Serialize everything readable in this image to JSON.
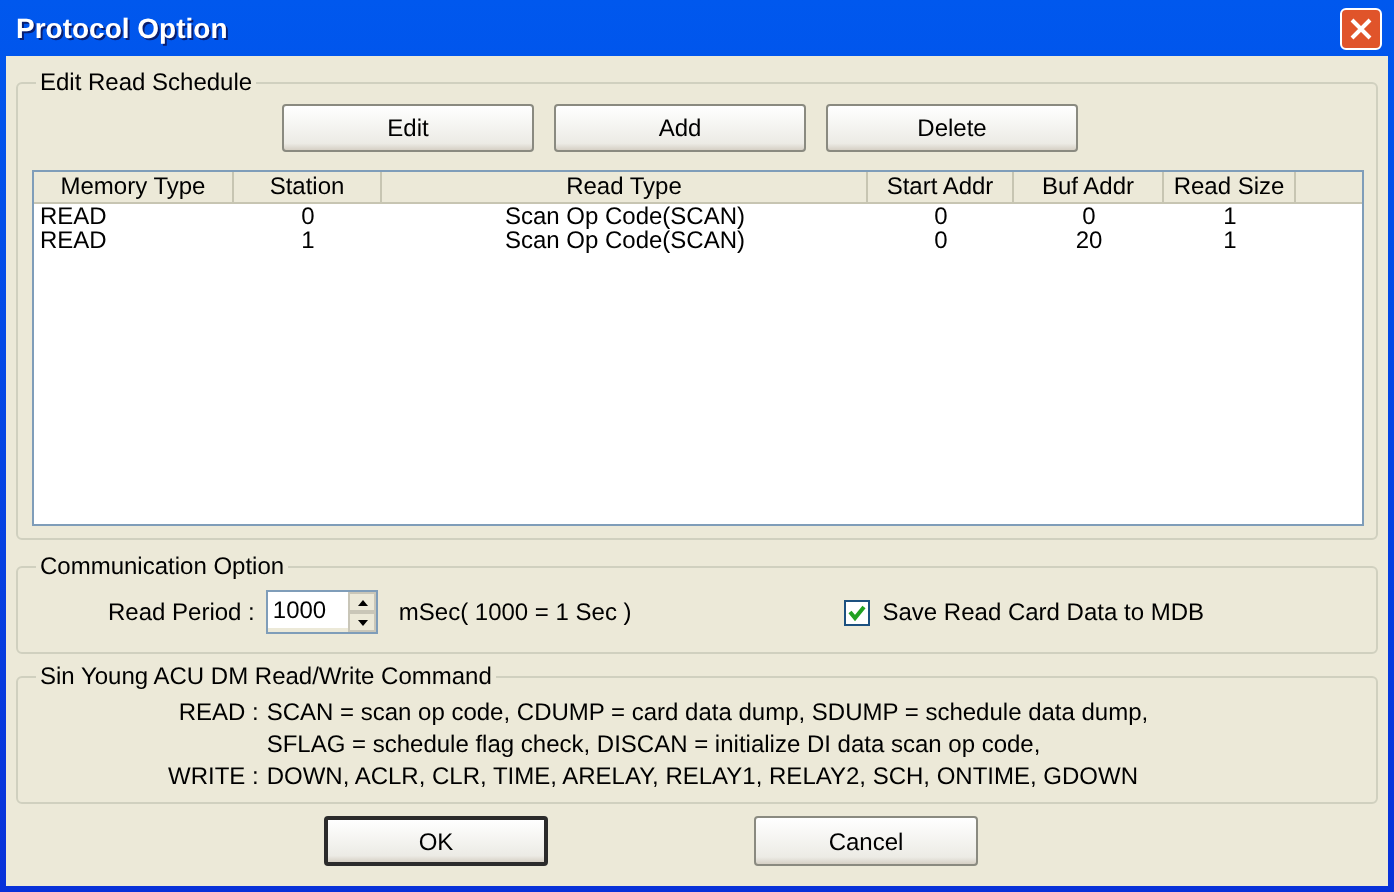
{
  "window": {
    "title": "Protocol Option"
  },
  "schedule": {
    "title": "Edit Read Schedule",
    "buttons": [
      "Edit",
      "Add",
      "Delete"
    ],
    "columns": [
      "Memory Type",
      "Station",
      "Read Type",
      "Start Addr",
      "Buf Addr",
      "Read Size"
    ],
    "rows": [
      {
        "cells": [
          "READ",
          "0",
          "Scan Op Code(SCAN)",
          "0",
          "0",
          "1"
        ],
        "selected": false
      },
      {
        "cells": [
          "READ",
          "1",
          "Scan Op Code(SCAN)",
          "0",
          "20",
          "1"
        ],
        "selected": false
      }
    ]
  },
  "communication": {
    "title": "Communication Option",
    "read_period_label": "Read Period :",
    "read_period_value": "1000",
    "unit_text": "mSec( 1000 = 1 Sec )",
    "save_to_mdb": {
      "label": "Save Read Card Data to MDB",
      "checked": true
    }
  },
  "commands": {
    "title": "Sin Young ACU DM Read/Write Command",
    "lines": [
      {
        "label": "READ :",
        "text": "SCAN = scan op code, CDUMP = card data dump, SDUMP = schedule data dump,"
      },
      {
        "text": "SFLAG = schedule flag check, DISCAN = initialize DI data scan op code,"
      },
      {
        "label": "WRITE :",
        "text": "DOWN, ACLR, CLR, TIME, ARELAY, RELAY1, RELAY2, SCH, ONTIME, GDOWN"
      }
    ]
  },
  "buttons": [
    {
      "label": "OK",
      "default": true
    },
    {
      "label": "Cancel",
      "default": false
    }
  ]
}
